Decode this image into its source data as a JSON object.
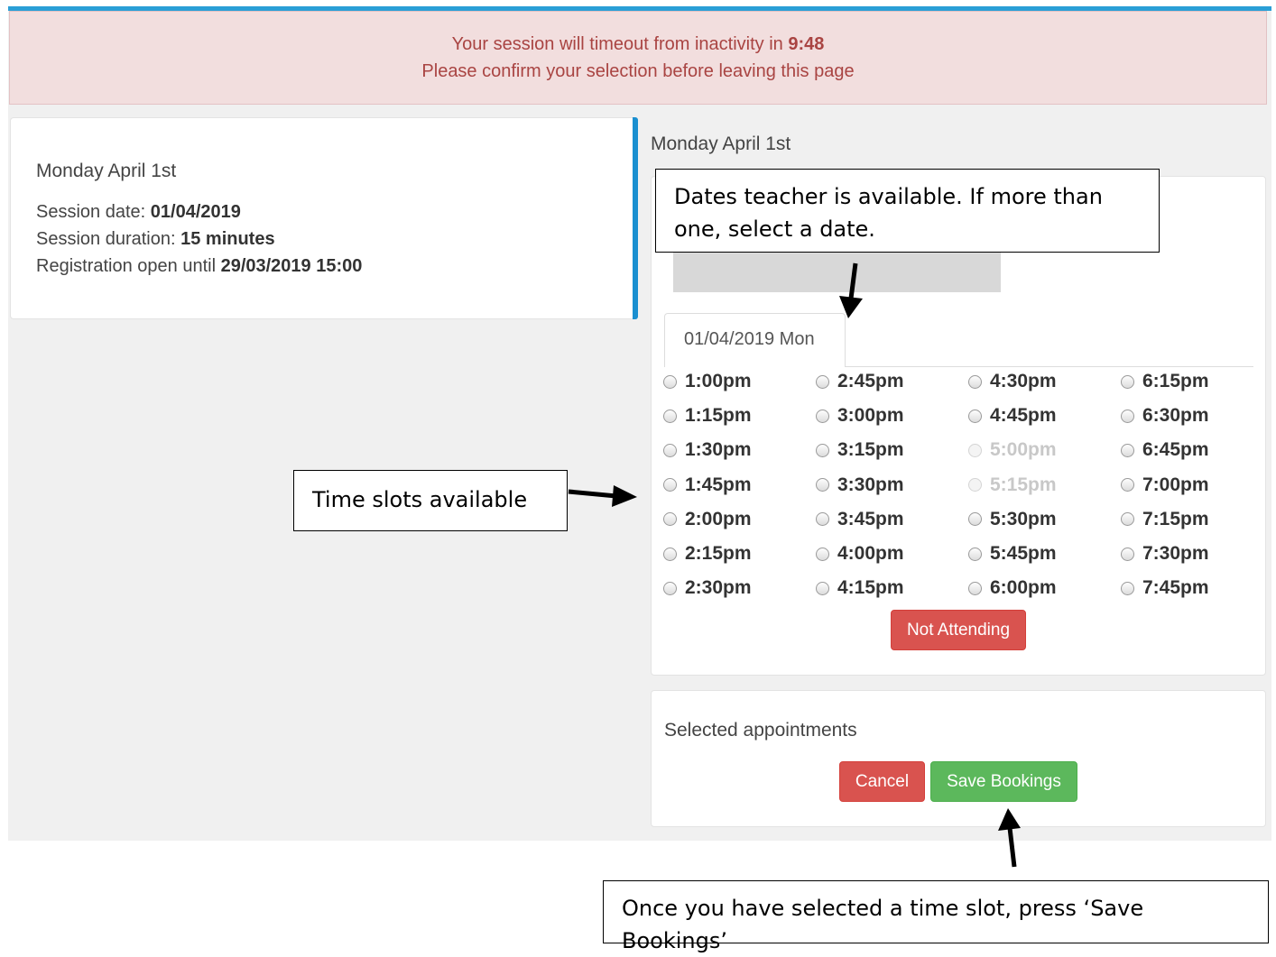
{
  "alert": {
    "line1_prefix": "Your session will timeout from inactivity in",
    "countdown": "9:48",
    "line2": "Please confirm your selection before leaving this page"
  },
  "session_info": {
    "title": "Monday April 1st",
    "date_label": "Session date:",
    "date_value": "01/04/2019",
    "duration_label": "Session duration:",
    "duration_value": "15 minutes",
    "registration_label": "Registration open until",
    "registration_value": "29/03/2019 15:00"
  },
  "booking": {
    "heading": "Monday April 1st",
    "date_tab": "01/04/2019 Mon",
    "slots": [
      [
        "1:00pm",
        "1:15pm",
        "1:30pm",
        "1:45pm",
        "2:00pm",
        "2:15pm",
        "2:30pm"
      ],
      [
        "2:45pm",
        "3:00pm",
        "3:15pm",
        "3:30pm",
        "3:45pm",
        "4:00pm",
        "4:15pm"
      ],
      [
        "4:30pm",
        "4:45pm",
        "5:00pm",
        "5:15pm",
        "5:30pm",
        "5:45pm",
        "6:00pm"
      ],
      [
        "6:15pm",
        "6:30pm",
        "6:45pm",
        "7:00pm",
        "7:15pm",
        "7:30pm",
        "7:45pm"
      ]
    ],
    "unavailable_slots": [
      "5:00pm",
      "5:15pm"
    ],
    "not_attending_label": "Not Attending"
  },
  "selected": {
    "title": "Selected appointments",
    "cancel_label": "Cancel",
    "save_label": "Save Bookings"
  },
  "callouts": {
    "dates": "Dates teacher is available. If more than one, select a date.",
    "slots": "Time slots available",
    "save": "Once you have selected a time slot, press ‘Save Bookings’"
  },
  "colors": {
    "accent_blue": "#2a9fd6",
    "alert_bg": "#f2dede",
    "alert_text": "#a94442",
    "danger": "#d9534f",
    "success": "#5cb85c"
  }
}
